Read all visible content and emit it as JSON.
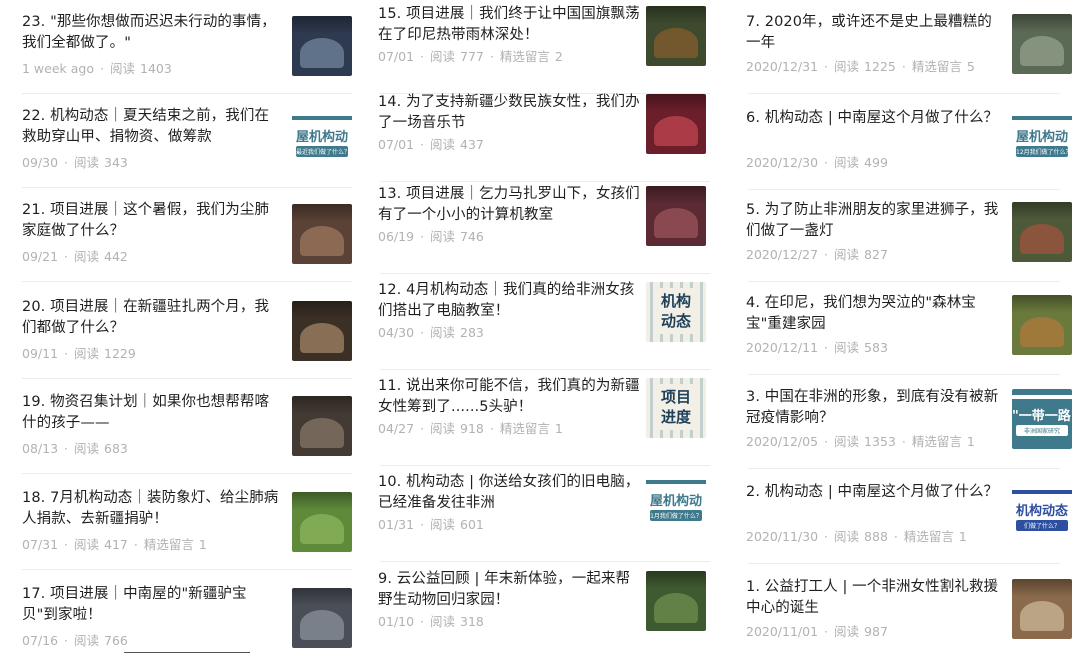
{
  "colors": {
    "title": "#1f1f1f",
    "meta": "#b2b2b2",
    "divider": "#ececec",
    "brand_teal": "#3f7a8c"
  },
  "labels": {
    "read": "阅读",
    "comments": "精选留言"
  },
  "columns": [
    {
      "items": [
        {
          "title": "23. \"那些你想做而迟迟未行动的事情，我们全都做了。\"",
          "date": "1 week ago",
          "reads": "1403",
          "thumb": {
            "kind": "photo",
            "icon": "crowd-photo",
            "bg": "#2e3a4f",
            "accent": "#8aa0bc"
          }
        },
        {
          "title": "22. 机构动态｜夏天结束之前，我们在救助穿山甲、捐物资、做筹款",
          "date": "09/30",
          "reads": "343",
          "thumb": {
            "kind": "brand",
            "icon": "org-update-banner",
            "bg": "#ffffff",
            "accent": "#3f7a8c",
            "text": "屋机构动",
            "sub": "最近我们做了什么？"
          }
        },
        {
          "title": "21. 项目进展｜这个暑假，我们为尘肺家庭做了什么？",
          "date": "09/21",
          "reads": "442",
          "thumb": {
            "kind": "photo",
            "icon": "hands-photo",
            "bg": "#5a4236",
            "accent": "#b48a6a"
          }
        },
        {
          "title": "20. 项目进展｜在新疆驻扎两个月，我们都做了什么？",
          "date": "09/11",
          "reads": "1229",
          "thumb": {
            "kind": "photo",
            "icon": "group-photo",
            "bg": "#3b3026",
            "accent": "#c6a27a"
          }
        },
        {
          "title": "19. 物资召集计划｜如果你也想帮帮喀什的孩子——",
          "date": "08/13",
          "reads": "683",
          "thumb": {
            "kind": "photo",
            "icon": "children-photo",
            "bg": "#433a33",
            "accent": "#9c8a76"
          }
        },
        {
          "title": "18. 7月机构动态｜装防象灯、给尘肺病人捐款、去新疆捐驴！",
          "date": "07/31",
          "reads": "417",
          "comments": "1",
          "thumb": {
            "kind": "photo",
            "icon": "grassland-photo",
            "bg": "#5f8a3a",
            "accent": "#9cc46a"
          }
        },
        {
          "title": "17. 项目进展｜中南屋的\"新疆驴宝贝\"到家啦！",
          "date": "07/16",
          "reads": "766",
          "thumb": {
            "kind": "photo",
            "icon": "village-photo",
            "bg": "#4a4f57",
            "accent": "#a3a9b2"
          }
        }
      ]
    },
    {
      "items": [
        {
          "title": "15. 项目进展｜我们终于让中国国旗飘荡在了印尼热带雨林深处！",
          "date": "07/01",
          "reads": "777",
          "comments": "2",
          "thumb": {
            "kind": "photo",
            "icon": "rainforest-cabin-photo",
            "bg": "#3d4a2e",
            "accent": "#a0642e"
          }
        },
        {
          "title": "14. 为了支持新疆少数民族女性，我们办了一场音乐节",
          "date": "07/01",
          "reads": "437",
          "thumb": {
            "kind": "photo",
            "icon": "music-festival-photo",
            "bg": "#6b1f2a",
            "accent": "#e0525e"
          }
        },
        {
          "title": "13. 项目进展｜乞力马扎罗山下，女孩们有了一个小小的计算机教室",
          "date": "06/19",
          "reads": "746",
          "thumb": {
            "kind": "photo",
            "icon": "classroom-photo",
            "bg": "#5b2a32",
            "accent": "#b0606a"
          }
        },
        {
          "title": "12. 4月机构动态｜我们真的给非洲女孩们搭出了电脑教室！",
          "date": "04/30",
          "reads": "283",
          "thumb": {
            "kind": "pattern",
            "icon": "org-update-pattern",
            "bg": "#f2f0e6",
            "accent": "#2f6f86",
            "text": "机构",
            "text2": "动态"
          }
        },
        {
          "title": "11. 说出来你可能不信，我们真的为新疆女性筹到了......5头驴！",
          "date": "04/27",
          "reads": "918",
          "comments": "1",
          "thumb": {
            "kind": "pattern",
            "icon": "project-progress-pattern",
            "bg": "#f2f0e6",
            "accent": "#2f6f86",
            "text": "项目",
            "text2": "进度"
          }
        },
        {
          "title": "10. 机构动态 | 你送给女孩们的旧电脑，已经准备发往非洲",
          "date": "01/31",
          "reads": "601",
          "thumb": {
            "kind": "brand",
            "icon": "org-update-banner",
            "bg": "#ffffff",
            "accent": "#3f7a8c",
            "text": "屋机构动",
            "sub": "1月我们做了什么？"
          }
        },
        {
          "title": "9. 云公益回顾 | 年末新体验，一起来帮野生动物回归家园！",
          "date": "01/10",
          "reads": "318",
          "thumb": {
            "kind": "photo",
            "icon": "forest-people-photo",
            "bg": "#3e5a30",
            "accent": "#7fa35a"
          }
        }
      ]
    },
    {
      "items": [
        {
          "title": "7. 2020年，或许还不是史上最糟糕的一年",
          "date": "2020/12/31",
          "reads": "1225",
          "comments": "5",
          "thumb": {
            "kind": "photo",
            "icon": "volunteers-photo",
            "bg": "#5b6a55",
            "accent": "#a8b4a0"
          }
        },
        {
          "title": "6. 机构动态 | 中南屋这个月做了什么？",
          "date": "2020/12/30",
          "reads": "499",
          "thumb": {
            "kind": "brand",
            "icon": "org-update-banner",
            "bg": "#ffffff",
            "accent": "#3f7a8c",
            "text": "屋机构动",
            "sub": "12月我们做了什么？"
          }
        },
        {
          "title": "5. 为了防止非洲朋友的家里进狮子，我们做了一盏灯",
          "date": "2020/12/27",
          "reads": "827",
          "thumb": {
            "kind": "photo",
            "icon": "lamp-photo",
            "bg": "#4d5a3a",
            "accent": "#c05040"
          }
        },
        {
          "title": "4. 在印尼，我们想为哭泣的\"森林宝宝\"重建家园",
          "date": "2020/12/11",
          "reads": "583",
          "thumb": {
            "kind": "photo",
            "icon": "orangutan-photo",
            "bg": "#6a7a3c",
            "accent": "#c9783a"
          }
        },
        {
          "title": "3. 中国在非洲的形象，到底有没有被新冠疫情影响？",
          "date": "2020/12/05",
          "reads": "1353",
          "comments": "1",
          "thumb": {
            "kind": "brand",
            "icon": "report-banner",
            "bg": "#3f7a8c",
            "accent": "#ffffff",
            "text": "\"一带一路\"",
            "sub": "非洲国家研究"
          }
        },
        {
          "title": "2. 机构动态 | 中南屋这个月做了什么？",
          "date": "2020/11/30",
          "reads": "888",
          "comments": "1",
          "thumb": {
            "kind": "brand",
            "icon": "org-update-banner-blue",
            "bg": "#ffffff",
            "accent": "#2d4fa0",
            "text": "机构动态",
            "sub": "们做了什么？"
          }
        },
        {
          "title": "1. 公益打工人 | 一个非洲女性割礼救援中心的诞生",
          "date": "2020/11/01",
          "reads": "987",
          "thumb": {
            "kind": "photo",
            "icon": "signboard-photo",
            "bg": "#8a6a4a",
            "accent": "#e4d2b6"
          }
        }
      ]
    }
  ]
}
